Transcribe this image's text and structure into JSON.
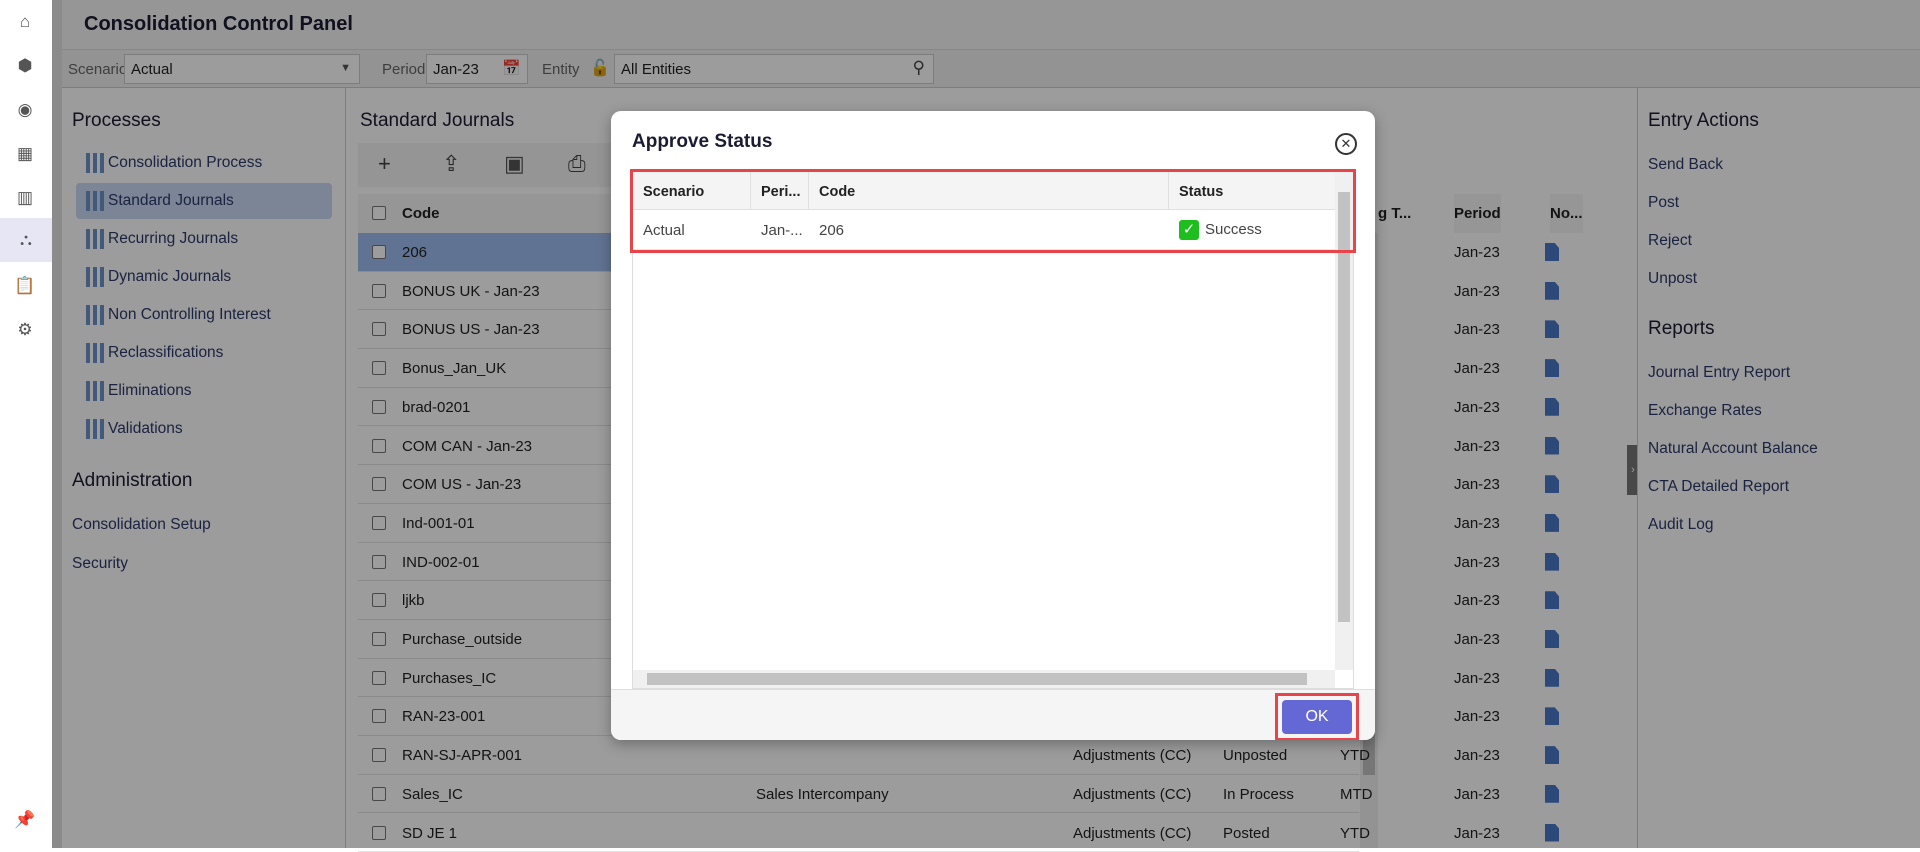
{
  "nav_icons": [
    "home-icon",
    "cube-icon",
    "target-icon",
    "grid-icon",
    "report-icon",
    "hierarchy-icon",
    "clipboard-check-icon",
    "gear-icon"
  ],
  "pin_icon": "pin-icon",
  "header": {
    "title": "Consolidation Control Panel"
  },
  "filters": {
    "scenario_label": "Scenario",
    "scenario_value": "Actual",
    "period_label": "Period",
    "period_value": "Jan-23",
    "entity_label": "Entity",
    "entity_value": "All Entities"
  },
  "processes": {
    "title": "Processes",
    "items": [
      "Consolidation Process",
      "Standard Journals",
      "Recurring Journals",
      "Dynamic Journals",
      "Non Controlling Interest",
      "Reclassifications",
      "Eliminations",
      "Validations"
    ],
    "selected": 1
  },
  "administration": {
    "title": "Administration",
    "items": [
      "Consolidation Setup",
      "Security"
    ]
  },
  "journals": {
    "title": "Standard Journals",
    "columns": {
      "code": "Code",
      "type": "g T...",
      "period": "Period",
      "notes": "No..."
    },
    "rows": [
      {
        "code": "206",
        "desc": "",
        "category": "",
        "status": "",
        "type": "",
        "period": "Jan-23"
      },
      {
        "code": "BONUS UK - Jan-23",
        "desc": "",
        "category": "",
        "status": "",
        "type": "",
        "period": "Jan-23"
      },
      {
        "code": "BONUS US - Jan-23",
        "desc": "",
        "category": "",
        "status": "",
        "type": "",
        "period": "Jan-23"
      },
      {
        "code": "Bonus_Jan_UK",
        "desc": "",
        "category": "",
        "status": "",
        "type": "",
        "period": "Jan-23"
      },
      {
        "code": "brad-0201",
        "desc": "",
        "category": "",
        "status": "",
        "type": "",
        "period": "Jan-23"
      },
      {
        "code": "COM CAN - Jan-23",
        "desc": "",
        "category": "",
        "status": "",
        "type": "",
        "period": "Jan-23"
      },
      {
        "code": "COM US - Jan-23",
        "desc": "",
        "category": "",
        "status": "",
        "type": "",
        "period": "Jan-23"
      },
      {
        "code": "Ind-001-01",
        "desc": "",
        "category": "",
        "status": "",
        "type": "",
        "period": "Jan-23"
      },
      {
        "code": "IND-002-01",
        "desc": "",
        "category": "",
        "status": "",
        "type": "",
        "period": "Jan-23"
      },
      {
        "code": "ljkb",
        "desc": "",
        "category": "",
        "status": "",
        "type": "",
        "period": "Jan-23"
      },
      {
        "code": "Purchase_outside",
        "desc": "",
        "category": "",
        "status": "",
        "type": "",
        "period": "Jan-23"
      },
      {
        "code": "Purchases_IC",
        "desc": "",
        "category": "",
        "status": "",
        "type": "",
        "period": "Jan-23"
      },
      {
        "code": "RAN-23-001",
        "desc": "",
        "category": "",
        "status": "",
        "type": "",
        "period": "Jan-23"
      },
      {
        "code": "RAN-SJ-APR-001",
        "desc": "",
        "category": "Adjustments (CC)",
        "status": "Unposted",
        "type": "YTD",
        "period": "Jan-23"
      },
      {
        "code": "Sales_IC",
        "desc": "Sales Intercompany",
        "category": "Adjustments (CC)",
        "status": "In Process",
        "type": "MTD",
        "period": "Jan-23"
      },
      {
        "code": "SD JE 1",
        "desc": "",
        "category": "Adjustments (CC)",
        "status": "Posted",
        "type": "YTD",
        "period": "Jan-23"
      }
    ],
    "selected_row": 0
  },
  "entry_actions": {
    "title": "Entry Actions",
    "items": [
      "Send Back",
      "Post",
      "Reject",
      "Unpost"
    ]
  },
  "reports": {
    "title": "Reports",
    "items": [
      "Journal Entry Report",
      "Exchange Rates",
      "Natural Account Balance",
      "CTA Detailed Report",
      "Audit Log"
    ]
  },
  "modal": {
    "title": "Approve Status",
    "columns": [
      "Scenario",
      "Peri...",
      "Code",
      "Status"
    ],
    "row": [
      "Actual",
      "Jan-...",
      "206",
      "Success"
    ],
    "ok_label": "OK",
    "status_color": "#1fbe1f",
    "highlight_color": "#e8444a",
    "button_color": "#6468d4"
  }
}
